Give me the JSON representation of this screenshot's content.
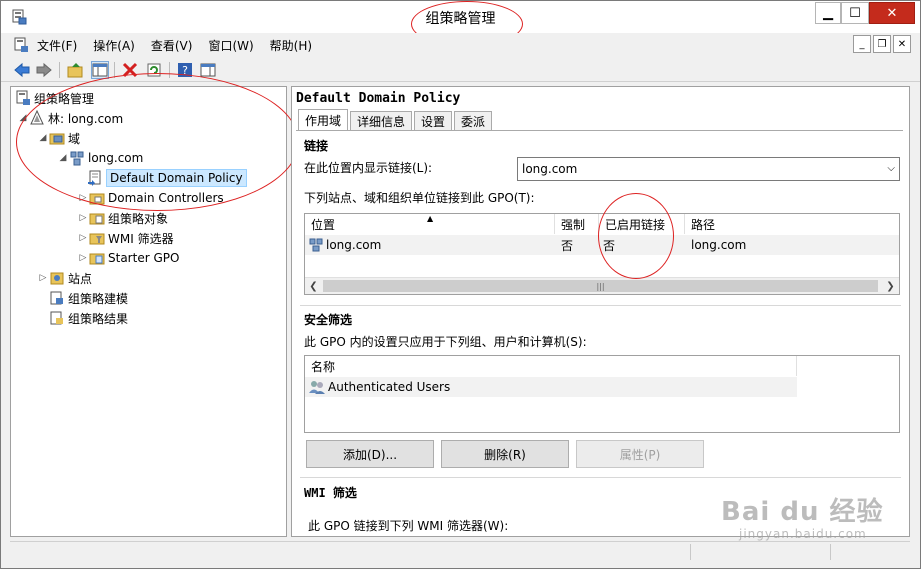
{
  "window": {
    "title": "组策略管理"
  },
  "menu": {
    "items": [
      "文件(F)",
      "操作(A)",
      "查看(V)",
      "窗口(W)",
      "帮助(H)"
    ]
  },
  "tree": {
    "nodes": [
      {
        "label": "组策略管理",
        "icon": "gpm-console-icon"
      },
      {
        "label": "林: long.com",
        "icon": "forest-icon"
      },
      {
        "label": "域",
        "icon": "domains-folder-icon"
      },
      {
        "label": "long.com",
        "icon": "domain-icon"
      },
      {
        "label": "Default Domain Policy",
        "icon": "gpo-link-icon"
      },
      {
        "label": "Domain Controllers",
        "icon": "ou-folder-icon"
      },
      {
        "label": "组策略对象",
        "icon": "gpo-folder-icon"
      },
      {
        "label": "WMI 筛选器",
        "icon": "wmi-folder-icon"
      },
      {
        "label": "Starter GPO",
        "icon": "starter-gpo-icon"
      },
      {
        "label": "站点",
        "icon": "sites-icon"
      },
      {
        "label": "组策略建模",
        "icon": "modeling-icon"
      },
      {
        "label": "组策略结果",
        "icon": "results-icon"
      }
    ]
  },
  "gpo": {
    "title": "Default Domain Policy",
    "tabs": [
      "作用域",
      "详细信息",
      "设置",
      "委派"
    ],
    "links": {
      "heading": "链接",
      "display_label": "在此位置内显示链接(L):",
      "display_value": "long.com",
      "list_label": "下列站点、域和组织单位链接到此 GPO(T):",
      "columns": [
        "位置",
        "强制",
        "已启用链接",
        "路径"
      ],
      "rows": [
        {
          "location": "long.com",
          "enforced": "否",
          "enabled": "否",
          "path": "long.com"
        }
      ]
    },
    "security": {
      "heading": "安全筛选",
      "description": "此 GPO 内的设置只应用于下列组、用户和计算机(S):",
      "column": "名称",
      "rows": [
        "Authenticated Users"
      ],
      "buttons": {
        "add": "添加(D)...",
        "remove": "删除(R)",
        "properties": "属性(P)"
      }
    },
    "wmi": {
      "heading": "WMI 筛选",
      "description": "此 GPO 链接到下列 WMI 筛选器(W):"
    }
  },
  "watermark": {
    "main": "Bai du 经验",
    "sub": "jingyan.baidu.com"
  },
  "colors": {
    "annotation_red": "#dd2222",
    "close_red": "#c42b1c",
    "selection": "#cce8ff"
  }
}
